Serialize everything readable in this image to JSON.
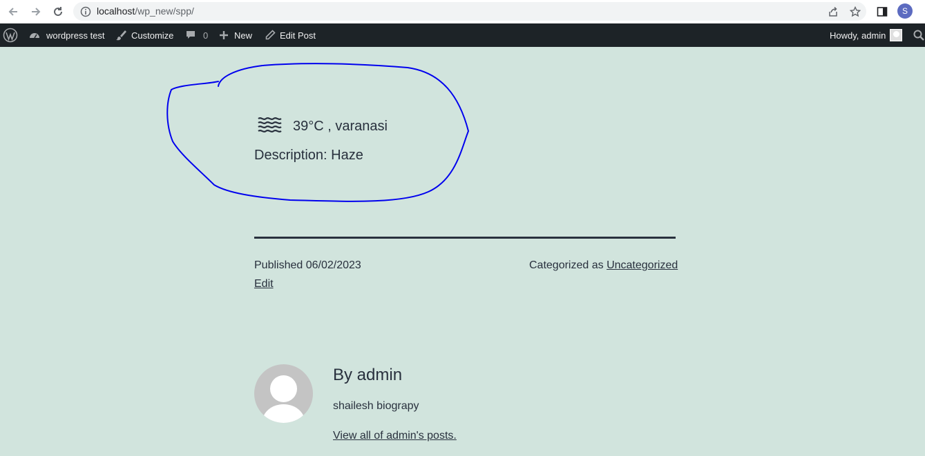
{
  "browser": {
    "url_host": "localhost",
    "url_path": "/wp_new/spp/",
    "profile_initial": "S",
    "icons": [
      "back-icon",
      "forward-icon",
      "reload-icon",
      "info-icon",
      "share-icon",
      "star-icon",
      "side-panel-icon"
    ]
  },
  "adminbar": {
    "site_name": "wordpress test",
    "customize": "Customize",
    "comments_count": "0",
    "new": "New",
    "edit_post": "Edit Post",
    "howdy": "Howdy, admin"
  },
  "weather": {
    "temp_location": "39°C , varanasi",
    "description": "Description: Haze",
    "icon": "haze-icon"
  },
  "post_meta": {
    "published": "Published 06/02/2023",
    "categorized_prefix": "Categorized as",
    "category": "Uncategorized",
    "edit": "Edit"
  },
  "author": {
    "name": "By admin",
    "bio": "shailesh biograpy",
    "link": "View all of admin's posts."
  },
  "colors": {
    "background": "#d1e4dd",
    "adminbar": "#1d2327",
    "text": "#28303d",
    "annotation": "#0000ee"
  }
}
